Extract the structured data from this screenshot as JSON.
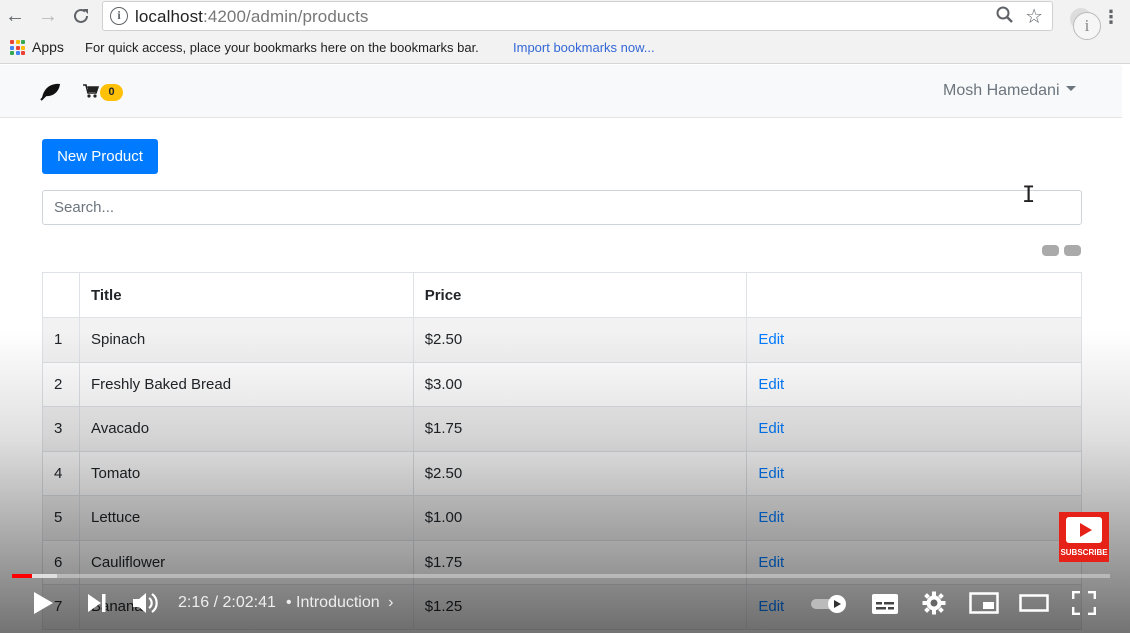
{
  "browser": {
    "url_host": "localhost",
    "url_path": ":4200/admin/products",
    "apps_label": "Apps",
    "bookmarks_message": "For quick access, place your bookmarks here on the bookmarks bar.",
    "import_bookmarks": "Import bookmarks now...",
    "apps_grid_colors": [
      "#ea4335",
      "#fbbc05",
      "#34a853",
      "#4285f4",
      "#ea4335",
      "#fbbc05",
      "#34a853",
      "#4285f4",
      "#ea4335"
    ]
  },
  "navbar": {
    "brand_icon": "leaf-icon",
    "cart_icon": "shopping-cart-icon",
    "cart_count": "0",
    "user_name": "Mosh Hamedani"
  },
  "main": {
    "new_product_label": "New Product",
    "search_placeholder": "Search...",
    "table": {
      "headers": [
        "",
        "Title",
        "Price",
        ""
      ],
      "rows": [
        {
          "index": "1",
          "title": "Spinach",
          "price": "$2.50",
          "action": "Edit"
        },
        {
          "index": "2",
          "title": "Freshly Baked Bread",
          "price": "$3.00",
          "action": "Edit"
        },
        {
          "index": "3",
          "title": "Avacado",
          "price": "$1.75",
          "action": "Edit"
        },
        {
          "index": "4",
          "title": "Tomato",
          "price": "$2.50",
          "action": "Edit"
        },
        {
          "index": "5",
          "title": "Lettuce",
          "price": "$1.00",
          "action": "Edit"
        },
        {
          "index": "6",
          "title": "Cauliflower",
          "price": "$1.75",
          "action": "Edit"
        },
        {
          "index": "7",
          "title": "Banana",
          "price": "$1.25",
          "action": "Edit"
        }
      ]
    }
  },
  "video_player": {
    "subscribe_label": "SUBSCRIBE",
    "current_time": "2:16",
    "duration": "2:02:41",
    "chapter": "Introduction",
    "progress_fraction": 0.018,
    "accent": "#ff0000"
  }
}
